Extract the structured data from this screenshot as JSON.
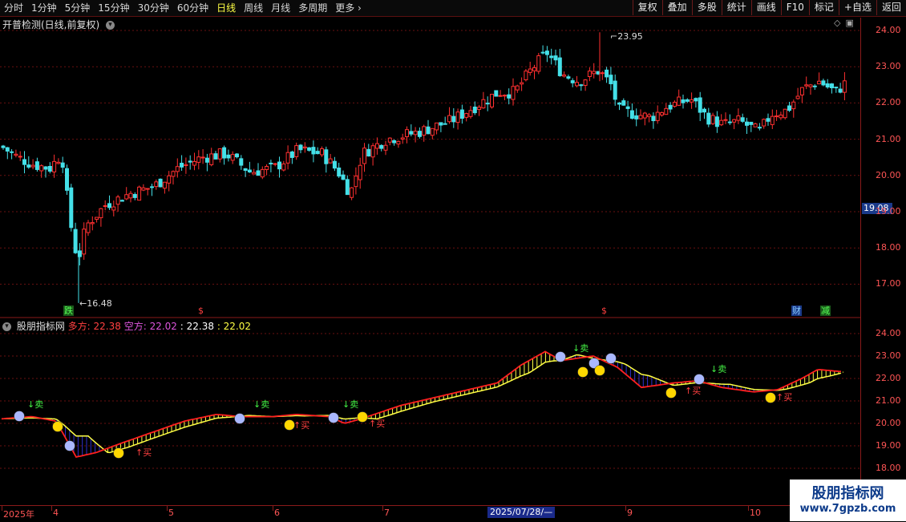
{
  "toolbar": {
    "periods": [
      "分时",
      "1分钟",
      "5分钟",
      "15分钟",
      "30分钟",
      "60分钟",
      "日线",
      "周线",
      "月线",
      "多周期"
    ],
    "active_period": "日线",
    "more_label": "更多",
    "more_icon": "chevron-right-icon",
    "tools": [
      "复权",
      "叠加",
      "多股",
      "统计",
      "画线",
      "F10",
      "标记",
      "+自选",
      "返回"
    ]
  },
  "main_chart": {
    "title": "开普检测(日线,前复权)",
    "high_label": "23.95",
    "low_label": "16.48",
    "current_price": "19.08",
    "price_axis": [
      "24.00",
      "23.00",
      "22.00",
      "21.00",
      "20.00",
      "19.00",
      "18.00",
      "17.00"
    ],
    "events": {
      "die": "跌",
      "s1": "$",
      "s2": "$",
      "cai": "财",
      "jian": "减"
    },
    "colors": {
      "up": "#ff3030",
      "down": "#44e0e8",
      "grid": "#6a1010",
      "axis": "#ff5555"
    }
  },
  "indicator": {
    "name": "股朋指标网",
    "duo_label": "多方: 22.38",
    "kong_label": "空方: 22.02",
    "v1": ": 22.38",
    "v2": ": 22.02",
    "axis": [
      "24.00",
      "23.00",
      "22.00",
      "21.00",
      "20.00",
      "19.00",
      "18.00"
    ],
    "sell_label": "↓卖",
    "buy_label": "↑买"
  },
  "dates": {
    "labels": [
      "2025年",
      "4",
      "5",
      "6",
      "7",
      "9",
      "10"
    ],
    "cursor": "2025/07/28/—"
  },
  "watermark": {
    "name": "股朋指标网",
    "url": "www.7gpzb.com"
  },
  "icons": {
    "diamond": "diamond-icon",
    "layout": "layout-icon",
    "collapse": "chevron-down-icon"
  }
}
